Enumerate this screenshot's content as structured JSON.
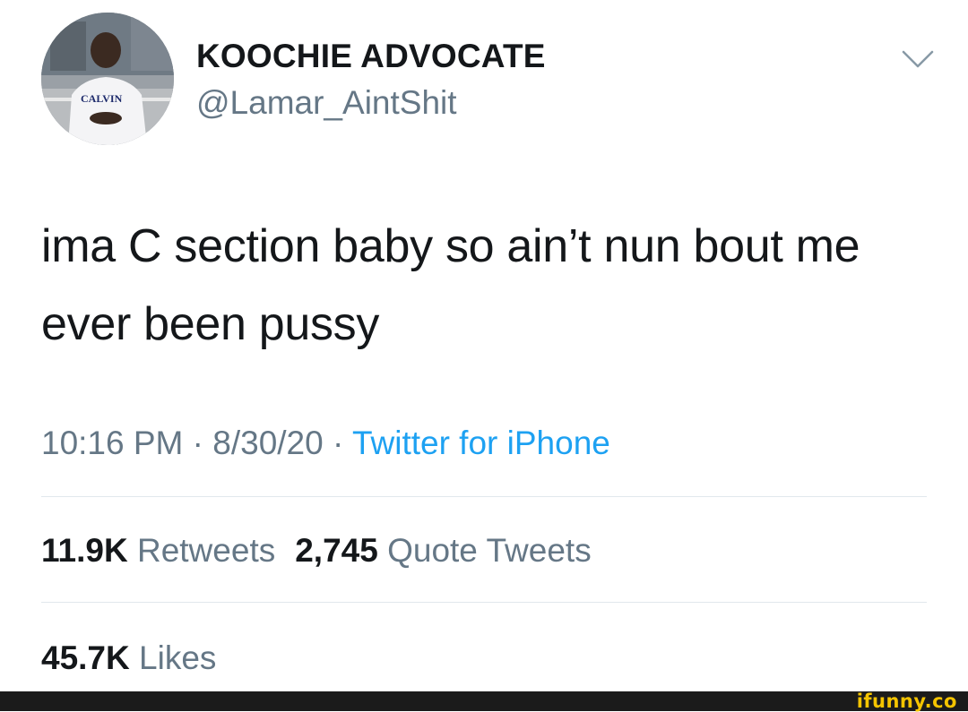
{
  "user": {
    "display_name": "KOOCHIE ADVOCATE",
    "handle": "@Lamar_AintShit",
    "avatar_shirt_text": "CALVIN"
  },
  "tweet": {
    "text": "ima C section baby so ain’t nun bout me ever been pussy",
    "time": "10:16 PM",
    "date": "8/30/20",
    "separator": " · ",
    "source": "Twitter for iPhone"
  },
  "stats": {
    "retweets_count": "11.9K",
    "retweets_label": "Retweets",
    "quotes_count": "2,745",
    "quotes_label": "Quote Tweets",
    "likes_count": "45.7K",
    "likes_label": "Likes"
  },
  "icons": {
    "menu": "chevron-down-icon"
  },
  "colors": {
    "text": "#14171a",
    "secondary": "#657786",
    "link": "#1da1f2",
    "divider": "#e1e8ed",
    "footer_bg": "#1b1b1b",
    "watermark": "#f5c400"
  },
  "footer": {
    "watermark": "ifunny.co"
  }
}
